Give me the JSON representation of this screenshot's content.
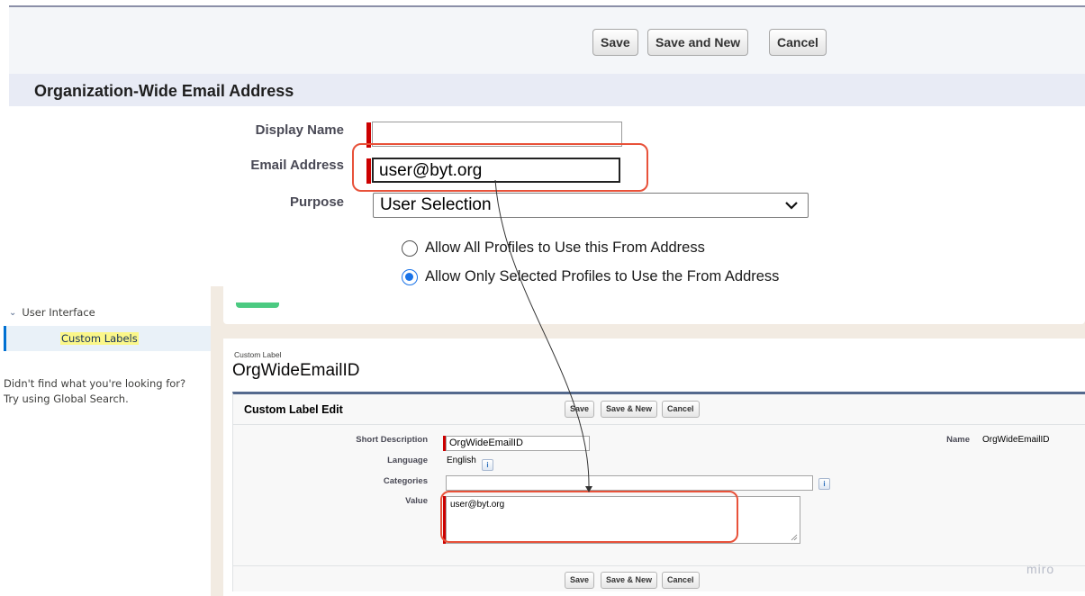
{
  "top_dialog": {
    "buttons": {
      "save": "Save",
      "save_and_new": "Save and New",
      "cancel": "Cancel"
    },
    "section_title": "Organization-Wide Email Address",
    "display_name": {
      "label": "Display Name",
      "value": ""
    },
    "email_address": {
      "label": "Email Address",
      "value": "user@byt.org"
    },
    "purpose": {
      "label": "Purpose",
      "value": "User Selection"
    },
    "radio_all": "Allow All Profiles to Use this From Address",
    "radio_selected": "Allow Only Selected Profiles to Use the From Address"
  },
  "sidebar": {
    "tree_parent": "User Interface",
    "tree_selected": "Custom Labels",
    "help_line1": "Didn't find what you're looking for?",
    "help_line2": "Try using Global Search."
  },
  "custom_label": {
    "subtitle": "Custom Label",
    "title": "OrgWideEmailID",
    "edit_title": "Custom Label Edit",
    "buttons": {
      "save": "Save",
      "save_and_new": "Save & New",
      "cancel": "Cancel"
    },
    "short_description": {
      "label": "Short Description",
      "value": "OrgWideEmailID"
    },
    "language": {
      "label": "Language",
      "value": "English"
    },
    "categories": {
      "label": "Categories",
      "value": ""
    },
    "value_field": {
      "label": "Value",
      "value": "user@byt.org"
    },
    "name": {
      "label": "Name",
      "value": "OrgWideEmailID"
    },
    "info_glyph": "i"
  },
  "watermark": "miro",
  "colors": {
    "highlight": "#e8523a",
    "required": "#cc0000",
    "radio_on": "#1a73e8"
  }
}
